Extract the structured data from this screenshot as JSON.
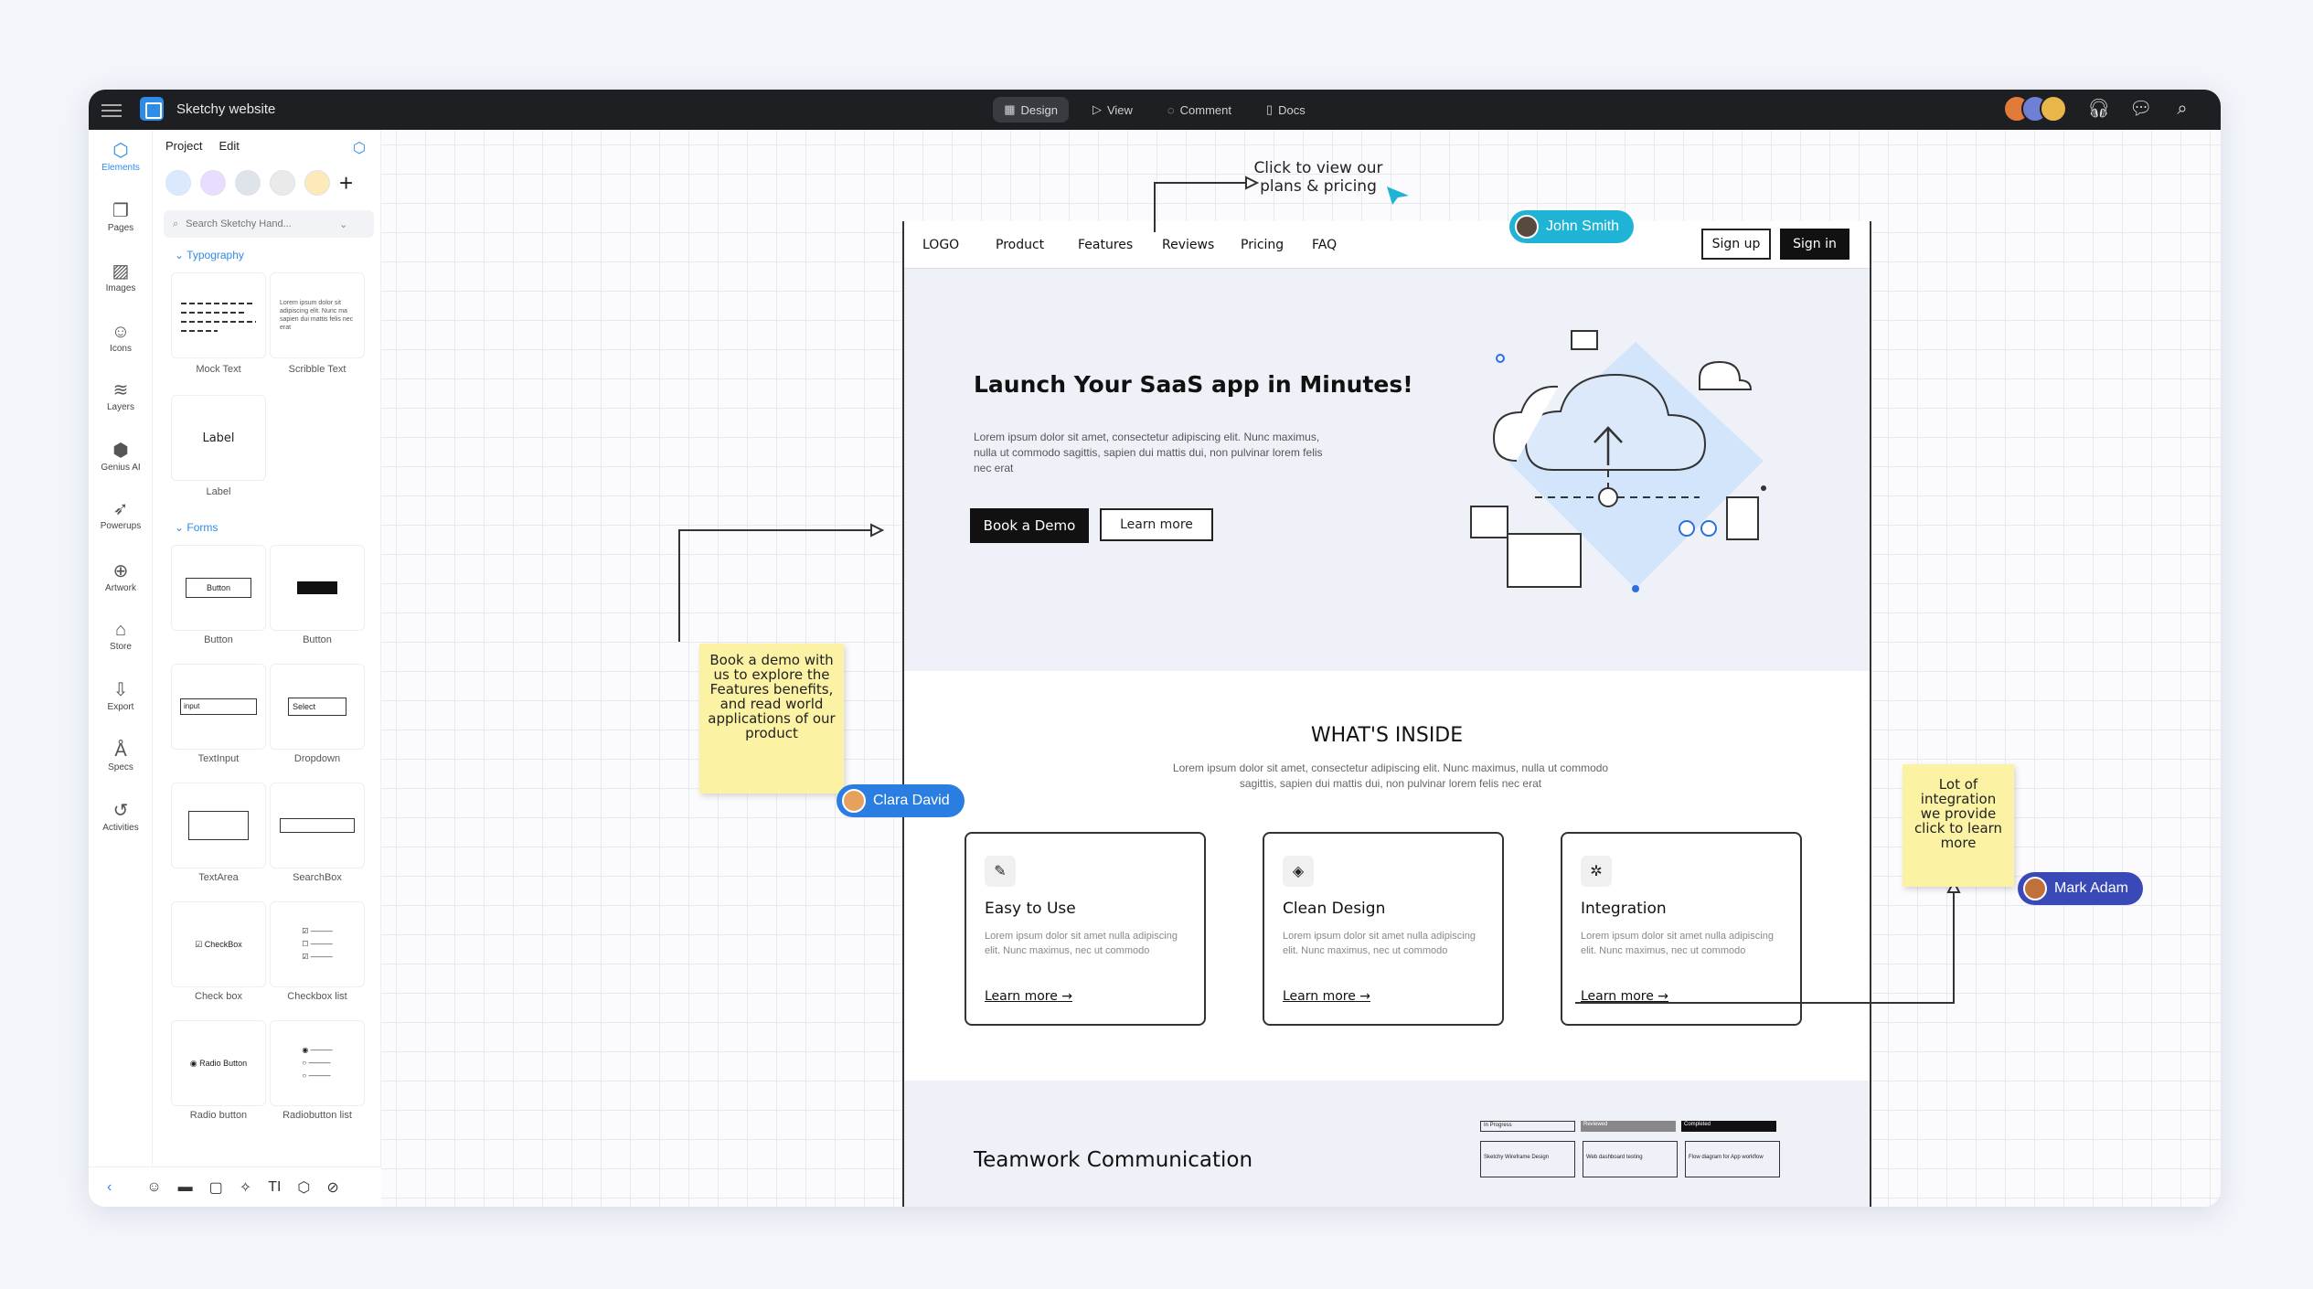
{
  "topbar": {
    "title": "Sketchy website",
    "tabs": [
      {
        "label": "Design",
        "active": true
      },
      {
        "label": "View"
      },
      {
        "label": "Comment"
      },
      {
        "label": "Docs"
      }
    ]
  },
  "rail": [
    {
      "label": "Elements",
      "icon": "cube-icon",
      "active": true
    },
    {
      "label": "Pages",
      "icon": "pages-icon"
    },
    {
      "label": "Images",
      "icon": "image-icon"
    },
    {
      "label": "Icons",
      "icon": "smiley-icon"
    },
    {
      "label": "Layers",
      "icon": "layers-icon"
    },
    {
      "label": "Genius AI",
      "icon": "ai-icon"
    },
    {
      "label": "Powerups",
      "icon": "rocket-icon"
    },
    {
      "label": "Artwork",
      "icon": "globe-icon"
    },
    {
      "label": "Store",
      "icon": "bag-icon"
    },
    {
      "label": "Export",
      "icon": "export-icon"
    },
    {
      "label": "Specs",
      "icon": "specs-icon"
    },
    {
      "label": "Activities",
      "icon": "history-icon"
    }
  ],
  "panel": {
    "tab_project": "Project",
    "tab_edit": "Edit",
    "search_placeholder": "Search Sketchy Hand...",
    "section_typography": "Typography",
    "section_forms": "Forms",
    "tiles": {
      "mock_text": "Mock Text",
      "scribble_text": "Scribble Text",
      "label": "Label",
      "label_preview": "Label",
      "button": "Button",
      "button_preview": "Button",
      "button2": "Button",
      "textinput": "TextInput",
      "textinput_preview": "input",
      "dropdown": "Dropdown",
      "dropdown_preview": "Select",
      "textarea": "TextArea",
      "searchbox": "SearchBox",
      "checkbox": "Check box",
      "checkbox_preview": "CheckBox",
      "checkbox_list": "Checkbox list",
      "radio": "Radio button",
      "radio_preview": "Radio Button",
      "radio_list": "Radiobutton list",
      "scribble_preview": "Lorem ipsum dolor sit adipiscing elit. Nunc ma sapien dui mattis felis nec erat"
    }
  },
  "wireframe": {
    "nav": {
      "logo": "LOGO",
      "product": "Product",
      "features": "Features",
      "reviews": "Reviews",
      "pricing": "Pricing",
      "faq": "FAQ",
      "signup": "Sign up",
      "signin": "Sign in"
    },
    "hero": {
      "title": "Launch Your SaaS app in Minutes!",
      "body": "Lorem ipsum dolor sit amet, consectetur adipiscing elit. Nunc maximus, nulla ut commodo sagittis, sapien dui mattis dui, non pulvinar lorem felis nec erat",
      "primary": "Book a Demo",
      "secondary": "Learn more"
    },
    "inside": {
      "title": "WHAT'S INSIDE",
      "body": "Lorem ipsum dolor sit amet, consectetur adipiscing elit. Nunc maximus, nulla ut commodo sagittis, sapien dui mattis dui, non pulvinar lorem felis nec erat"
    },
    "cards": [
      {
        "title": "Easy to Use",
        "body": "Lorem ipsum dolor sit amet nulla adipiscing elit. Nunc maximus, nec ut commodo",
        "link": "Learn more",
        "icon": "edit-icon"
      },
      {
        "title": "Clean Design",
        "body": "Lorem ipsum dolor sit amet nulla adipiscing elit. Nunc maximus, nec ut commodo",
        "link": "Learn more",
        "icon": "layers-icon"
      },
      {
        "title": "Integration",
        "body": "Lorem ipsum dolor sit amet nulla adipiscing elit. Nunc maximus, nec ut commodo",
        "link": "Learn more",
        "icon": "puzzle-icon"
      }
    ],
    "team": {
      "title": "Teamwork Communication",
      "kanban": [
        "In Progress",
        "Reviewed",
        "Completed"
      ],
      "kanban_cards": [
        "Sketchy Wireframe Design",
        "Web dashboard testing",
        "Flow diagram for App workflow"
      ]
    }
  },
  "annotations": {
    "pricing_note": "Click to view our plans & pricing",
    "demo_note": "Book a demo with us to explore the Features benefits, and read world applications of our product",
    "integration_note": "Lot of integration we provide click to learn more"
  },
  "collaborators": {
    "john": "John Smith",
    "clara": "Clara David",
    "mark": "Mark Adam"
  },
  "colors": {
    "accent": "#2d8ce6",
    "john": "#1fb3d6",
    "clara": "#2a7de1",
    "mark": "#3a49b8"
  }
}
